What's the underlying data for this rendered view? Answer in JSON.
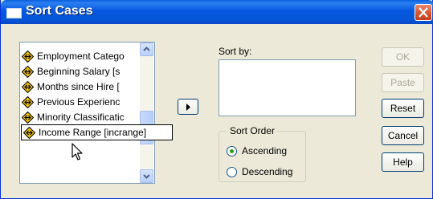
{
  "window": {
    "title": "Sort Cases"
  },
  "variables": [
    "Employment Catego",
    "Beginning Salary [s",
    "Months since Hire [",
    "Previous Experienc",
    "Minority Classificatic",
    "Income Range [incrange]"
  ],
  "sort_by": {
    "label": "Sort by:"
  },
  "sort_order": {
    "legend": "Sort Order",
    "ascending_label": "Ascending",
    "descending_label": "Descending",
    "selected": "Ascending"
  },
  "buttons": {
    "ok": "OK",
    "paste": "Paste",
    "reset": "Reset",
    "cancel": "Cancel",
    "help": "Help"
  },
  "colors": {
    "titlebar": "#0758e0",
    "dialog_bg": "#ece9d8",
    "var_icon": "#f0c000"
  }
}
